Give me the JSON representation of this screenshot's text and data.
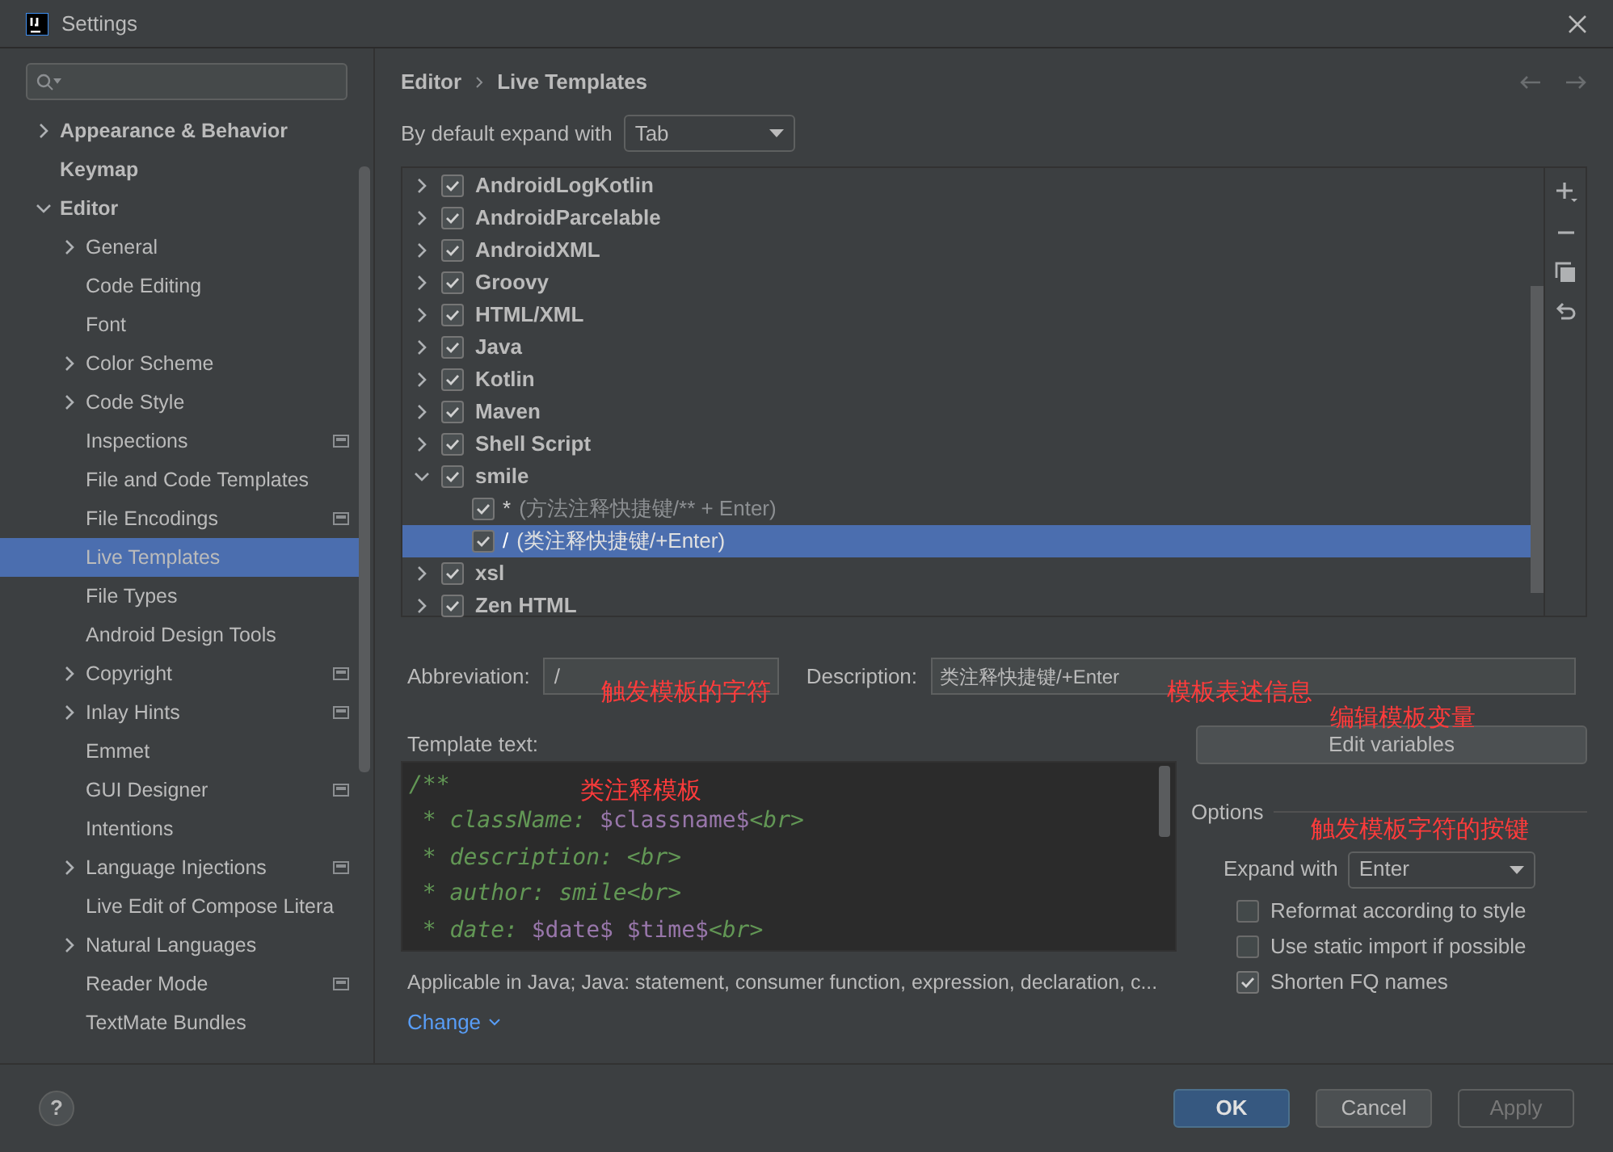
{
  "window": {
    "title": "Settings"
  },
  "sidebar": {
    "items": [
      {
        "label": "Appearance & Behavior",
        "bold": true,
        "expandable": true,
        "expanded": false,
        "badge": false,
        "selected": false
      },
      {
        "label": "Keymap",
        "bold": true,
        "expandable": false,
        "expanded": false,
        "badge": false,
        "selected": false
      },
      {
        "label": "Editor",
        "bold": true,
        "expandable": true,
        "expanded": true,
        "badge": false,
        "selected": false,
        "children": [
          {
            "label": "General",
            "expandable": true,
            "badge": false,
            "selected": false
          },
          {
            "label": "Code Editing",
            "expandable": false,
            "badge": false,
            "selected": false
          },
          {
            "label": "Font",
            "expandable": false,
            "badge": false,
            "selected": false
          },
          {
            "label": "Color Scheme",
            "expandable": true,
            "badge": false,
            "selected": false
          },
          {
            "label": "Code Style",
            "expandable": true,
            "badge": false,
            "selected": false
          },
          {
            "label": "Inspections",
            "expandable": false,
            "badge": true,
            "selected": false
          },
          {
            "label": "File and Code Templates",
            "expandable": false,
            "badge": false,
            "selected": false
          },
          {
            "label": "File Encodings",
            "expandable": false,
            "badge": true,
            "selected": false
          },
          {
            "label": "Live Templates",
            "expandable": false,
            "badge": false,
            "selected": true
          },
          {
            "label": "File Types",
            "expandable": false,
            "badge": false,
            "selected": false
          },
          {
            "label": "Android Design Tools",
            "expandable": false,
            "badge": false,
            "selected": false
          },
          {
            "label": "Copyright",
            "expandable": true,
            "badge": true,
            "selected": false
          },
          {
            "label": "Inlay Hints",
            "expandable": true,
            "badge": true,
            "selected": false
          },
          {
            "label": "Emmet",
            "expandable": false,
            "badge": false,
            "selected": false
          },
          {
            "label": "GUI Designer",
            "expandable": false,
            "badge": true,
            "selected": false
          },
          {
            "label": "Intentions",
            "expandable": false,
            "badge": false,
            "selected": false
          },
          {
            "label": "Language Injections",
            "expandable": true,
            "badge": true,
            "selected": false
          },
          {
            "label": "Live Edit of Compose Litera",
            "expandable": false,
            "badge": false,
            "selected": false
          },
          {
            "label": "Natural Languages",
            "expandable": true,
            "badge": false,
            "selected": false
          },
          {
            "label": "Reader Mode",
            "expandable": false,
            "badge": true,
            "selected": false
          },
          {
            "label": "TextMate Bundles",
            "expandable": false,
            "badge": false,
            "selected": false
          }
        ]
      }
    ]
  },
  "breadcrumb": [
    "Editor",
    "Live Templates"
  ],
  "expand_default": {
    "label": "By default expand with",
    "value": "Tab"
  },
  "templates": [
    {
      "label": "AndroidLogKotlin",
      "checked": true,
      "expanded": false,
      "selected": false
    },
    {
      "label": "AndroidParcelable",
      "checked": true,
      "expanded": false,
      "selected": false
    },
    {
      "label": "AndroidXML",
      "checked": true,
      "expanded": false,
      "selected": false
    },
    {
      "label": "Groovy",
      "checked": true,
      "expanded": false,
      "selected": false
    },
    {
      "label": "HTML/XML",
      "checked": true,
      "expanded": false,
      "selected": false
    },
    {
      "label": "Java",
      "checked": true,
      "expanded": false,
      "selected": false
    },
    {
      "label": "Kotlin",
      "checked": true,
      "expanded": false,
      "selected": false
    },
    {
      "label": "Maven",
      "checked": true,
      "expanded": false,
      "selected": false
    },
    {
      "label": "Shell Script",
      "checked": true,
      "expanded": false,
      "selected": false
    },
    {
      "label": "smile",
      "checked": true,
      "expanded": true,
      "selected": false,
      "children": [
        {
          "abbr": "*",
          "desc": "(方法注释快捷键/** + Enter)",
          "checked": true,
          "selected": false
        },
        {
          "abbr": "/",
          "desc": "(类注释快捷键/+Enter)",
          "checked": true,
          "selected": true
        }
      ]
    },
    {
      "label": "xsl",
      "checked": true,
      "expanded": false,
      "selected": false
    },
    {
      "label": "Zen HTML",
      "checked": true,
      "expanded": false,
      "selected": false
    }
  ],
  "abbreviation": {
    "label": "Abbreviation:",
    "value": "/"
  },
  "description": {
    "label": "Description:",
    "value": "类注释快捷键/+Enter"
  },
  "template_text": {
    "label": "Template text:",
    "lines": [
      [
        {
          "kind": "comment",
          "text": "/**"
        }
      ],
      [
        {
          "kind": "comment",
          "text": " * className: "
        },
        {
          "kind": "variable",
          "text": "$classname$"
        },
        {
          "kind": "comment",
          "text": "<br>"
        }
      ],
      [
        {
          "kind": "comment",
          "text": " * description: <br>"
        }
      ],
      [
        {
          "kind": "comment",
          "text": " * author: smile<br>"
        }
      ],
      [
        {
          "kind": "comment",
          "text": " * date: "
        },
        {
          "kind": "variable",
          "text": "$date$ $time$"
        },
        {
          "kind": "comment",
          "text": "<br>"
        }
      ]
    ]
  },
  "applicable": "Applicable in Java; Java: statement, consumer function, expression, declaration, c...",
  "change_link": "Change",
  "edit_variables": "Edit variables",
  "options": {
    "title": "Options",
    "expand_label": "Expand with",
    "expand_value": "Enter",
    "checkboxes": [
      {
        "label": "Reformat according to style",
        "checked": false
      },
      {
        "label": "Use static import if possible",
        "checked": false
      },
      {
        "label": "Shorten FQ names",
        "checked": true
      }
    ]
  },
  "annotations": [
    "触发模板的字符",
    "模板表述信息",
    "编辑模板变量",
    "类注释模板",
    "触发模板字符的按键"
  ],
  "help_button": "?",
  "buttons": [
    {
      "label": "OK",
      "kind": "primary"
    },
    {
      "label": "Cancel",
      "kind": "normal"
    },
    {
      "label": "Apply",
      "kind": "disabled"
    }
  ]
}
